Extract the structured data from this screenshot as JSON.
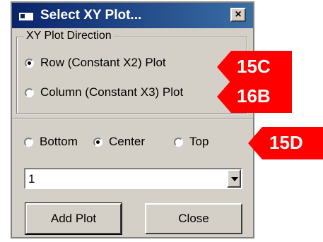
{
  "dialog": {
    "title": "Select XY Plot...",
    "close_glyph": "×",
    "direction_group": {
      "legend": "XY Plot Direction",
      "options": [
        {
          "label": "Row (Constant X2) Plot",
          "checked": true
        },
        {
          "label": "Column (Constant X3) Plot",
          "checked": false
        }
      ]
    },
    "position_options": [
      {
        "label": "Bottom",
        "checked": false
      },
      {
        "label": "Center",
        "checked": true
      },
      {
        "label": "Top",
        "checked": false
      }
    ],
    "combo": {
      "value": "1"
    },
    "buttons": {
      "add": "Add Plot",
      "close": "Close"
    }
  },
  "callouts": [
    {
      "label": "15C",
      "color": "#ff0000"
    },
    {
      "label": "16B",
      "color": "#ff0000"
    },
    {
      "label": "15D",
      "color": "#ff0000"
    }
  ],
  "colors": {
    "titlebar": "#0a246a",
    "face": "#d4d0c8",
    "callout": "#ff0000"
  },
  "icons": {
    "app": "window-icon",
    "close": "close-icon",
    "dropdown": "chevron-down-icon"
  }
}
